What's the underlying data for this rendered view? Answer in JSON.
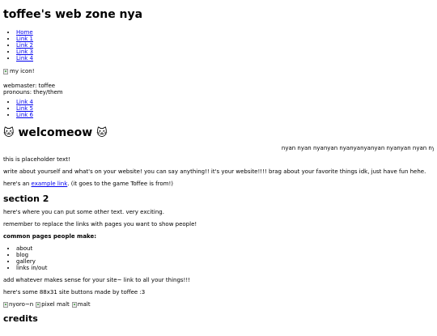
{
  "site": {
    "title": "toffee's web zone nya"
  },
  "nav_primary": [
    "Home",
    "Link 1",
    "Link 2",
    "Link 3",
    "Link 4"
  ],
  "icon": {
    "alt": "my icon!"
  },
  "webmaster": {
    "line1": "webmaster: toffee",
    "line2": "pronouns: they/them"
  },
  "nav_secondary": [
    "Link 4",
    "Link 5",
    "Link 6"
  ],
  "welcome": {
    "emoji_left": "🐱",
    "title": "welcomeow",
    "emoji_right": "🐱"
  },
  "marquee": {
    "text": "nyan nyan nyanyan nyanyanyanyan nyanyan nyan ny"
  },
  "intro": {
    "p1": "this is placeholder text!",
    "p2": "write about yourself and what's on your website! you can say anything!! it's your website!!!! brag about your favorite things idk, just have fun hehe.",
    "p3_before": "here's an ",
    "p3_link": "example link",
    "p3_after": ". (it goes to the game Toffee is from!)"
  },
  "section2": {
    "title": "section 2",
    "p1": "here's where you can put some other text. very exciting.",
    "p2": "remember to replace the links with pages you want to show people!",
    "common_title": "common pages people make:",
    "common_items": [
      "about",
      "blog",
      "gallery",
      "links in/out"
    ],
    "p3": "add whatever makes sense for your site~ link to all your things!!!",
    "p4": "here's some 88x31 site buttons made by toffee :3",
    "buttons": [
      "nyoro~n",
      "pixel malt",
      "malt"
    ]
  },
  "credits": {
    "title": "credits"
  }
}
